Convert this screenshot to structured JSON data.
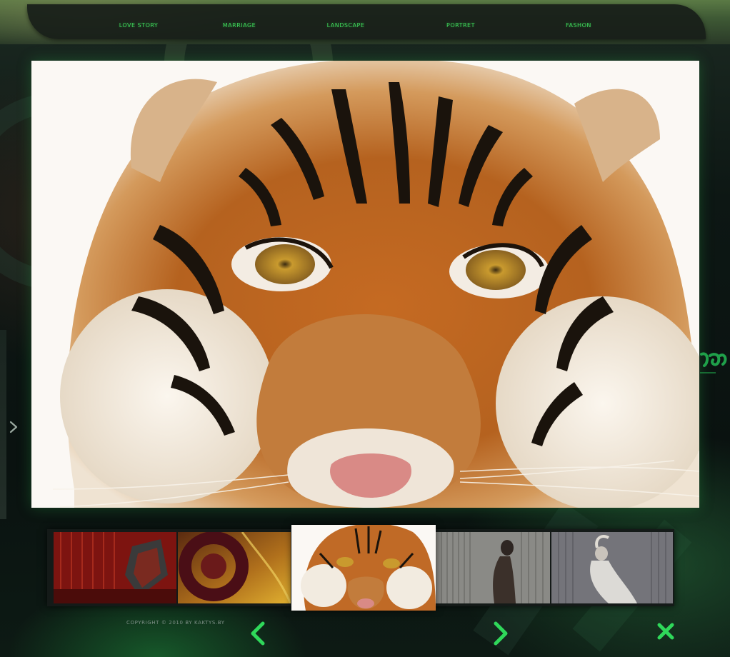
{
  "nav": {
    "items": [
      {
        "label": "LOVE STORY"
      },
      {
        "label": "MARRIAGE"
      },
      {
        "label": "LANDSCAPE"
      },
      {
        "label": "PORTRET"
      },
      {
        "label": "FASHON"
      }
    ]
  },
  "gallery": {
    "main_image_icon": "tiger-photo",
    "selected_index": 2,
    "thumbnails": [
      {
        "icon": "red-corridor-thumbnail"
      },
      {
        "icon": "abstract-circle-thumbnail"
      },
      {
        "icon": "tiger-thumbnail"
      },
      {
        "icon": "woman-striped-wall-thumbnail"
      },
      {
        "icon": "dancing-woman-thumbnail"
      }
    ]
  },
  "footer": {
    "copyright": "COPYRIGHT © 2010 BY KAKTYS.BY"
  },
  "colors": {
    "accent": "#3ed65a",
    "nav_bg": "#181e19",
    "page_bg": "#0c1311"
  },
  "icons": {
    "prev": "chevron-left-icon",
    "next": "chevron-right-icon",
    "close": "close-icon",
    "side": "chevron-right-icon"
  }
}
